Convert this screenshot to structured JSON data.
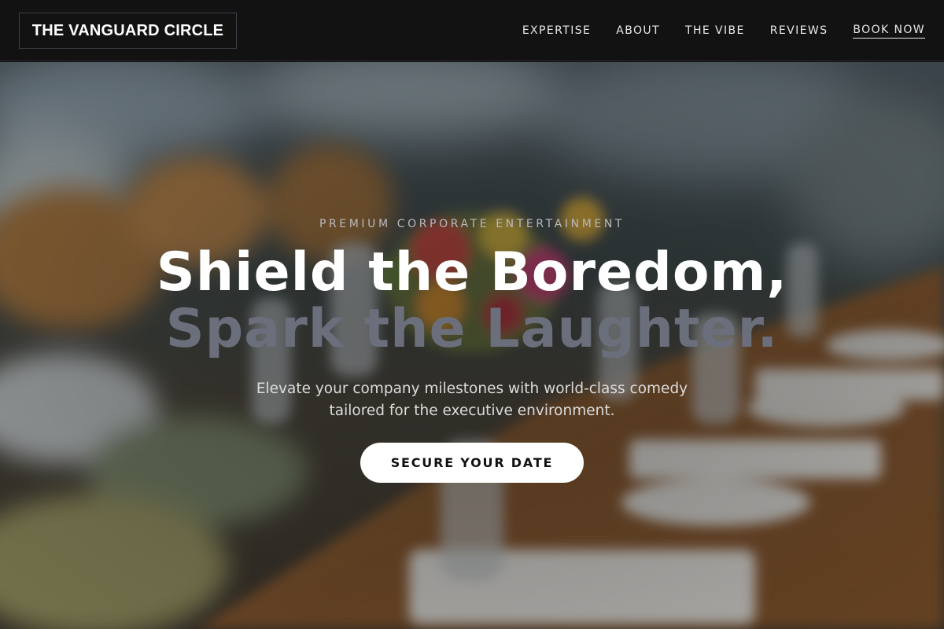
{
  "nav": {
    "logo": "THE VANGUARD CIRCLE",
    "links": [
      "EXPERTISE",
      "ABOUT",
      "THE VIBE",
      "REVIEWS",
      "BOOK NOW"
    ]
  },
  "hero": {
    "eyebrow": "PREMIUM CORPORATE ENTERTAINMENT",
    "headline_line1": "Shield the Boredom,",
    "headline_line2": "Spark the Laughter.",
    "subtext_line1": "Elevate your company milestones with world-class comedy",
    "subtext_line2": "tailored for the executive environment.",
    "cta_label": "SECURE YOUR DATE",
    "background_image": "blurred-banquet-table-photo"
  },
  "colors": {
    "nav_bg": "#121212",
    "headline_primary": "#ffffff",
    "headline_secondary": "#6b6f7c",
    "cta_bg": "#ffffff",
    "cta_text": "#101010"
  }
}
